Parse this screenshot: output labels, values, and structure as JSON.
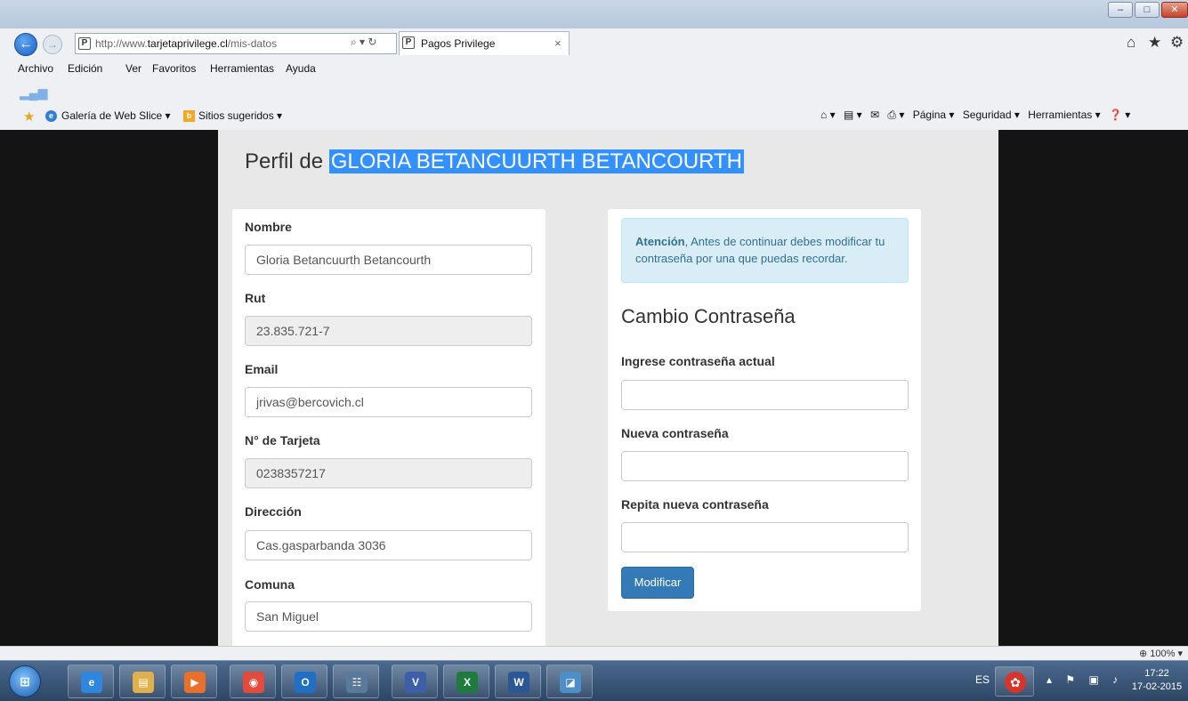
{
  "browser": {
    "url_prefix": "http://www.",
    "url_domain": "tarjetaprivilege.cl",
    "url_path": "/mis-datos",
    "address_tools": "⌕ ▾ ↻",
    "tab_title": "Pagos Privilege",
    "tab_close": "×",
    "site_icon_letter": "P",
    "window_buttons": {
      "minimize": "–",
      "maximize": "□",
      "close": "✕"
    },
    "back_glyph": "←",
    "forward_glyph": "→",
    "right_icons": {
      "home": "⌂",
      "favorites": "★",
      "tools": "⚙"
    },
    "menu": [
      "Archivo",
      "Edición",
      "Ver",
      "Favoritos",
      "Herramientas",
      "Ayuda"
    ],
    "favorites_bar": {
      "web_slice": "Galería de Web Slice ▾",
      "sugeridos": "Sitios sugeridos ▾"
    },
    "command_bar": [
      "⌂ ▾",
      "▤ ▾",
      "✉",
      "⎙ ▾",
      "Página ▾",
      "Seguridad ▾",
      "Herramientas ▾",
      "❓ ▾"
    ],
    "zoom": "⊕ 100%  ▾"
  },
  "page": {
    "title_prefix": "Perfil de ",
    "title_name": "GLORIA BETANCUURTH BETANCOURTH",
    "profile_fields": [
      {
        "label": "Nombre",
        "value": "Gloria Betancuurth Betancourth"
      },
      {
        "label": "Rut",
        "value": "23.835.721-7"
      },
      {
        "label": "Email",
        "value": "jrivas@bercovich.cl"
      },
      {
        "label": "N° de Tarjeta",
        "value": "0238357217"
      },
      {
        "label": "Dirección",
        "value": "Cas.gasparbanda 3036"
      },
      {
        "label": "Comuna",
        "value": "San Miguel"
      }
    ],
    "alert": {
      "strong": "Atención",
      "text": ", Antes de continuar debes modificar tu contraseña por una que puedas recordar."
    },
    "password": {
      "title": "Cambio Contraseña",
      "current_label": "Ingrese contraseña actual",
      "new_label": "Nueva contraseña",
      "repeat_label": "Repita nueva contraseña",
      "submit": "Modificar"
    }
  },
  "taskbar": {
    "start_glyph": "⊞",
    "apps": [
      {
        "name": "internet-explorer",
        "glyph": "e",
        "color": "#2e86de"
      },
      {
        "name": "file-explorer",
        "glyph": "▤",
        "color": "#e0b04a"
      },
      {
        "name": "media-player",
        "glyph": "▶",
        "color": "#e8702a"
      },
      {
        "name": "chrome",
        "glyph": "◉",
        "color": "#e54b3c"
      },
      {
        "name": "outlook",
        "glyph": "O",
        "color": "#1f6fc5"
      },
      {
        "name": "network-app",
        "glyph": "☷",
        "color": "#5a7a9a"
      },
      {
        "name": "visio",
        "glyph": "V",
        "color": "#3d5fa8"
      },
      {
        "name": "excel",
        "glyph": "X",
        "color": "#1f7a3d"
      },
      {
        "name": "word",
        "glyph": "W",
        "color": "#2b5797"
      },
      {
        "name": "notes-app",
        "glyph": "◪",
        "color": "#4f8fc9"
      }
    ],
    "language": "ES",
    "tray_special": "✿",
    "tray_icons": "▴ ⚑ ▣ ♪",
    "time": "17:22",
    "date": "17-02-2015"
  }
}
